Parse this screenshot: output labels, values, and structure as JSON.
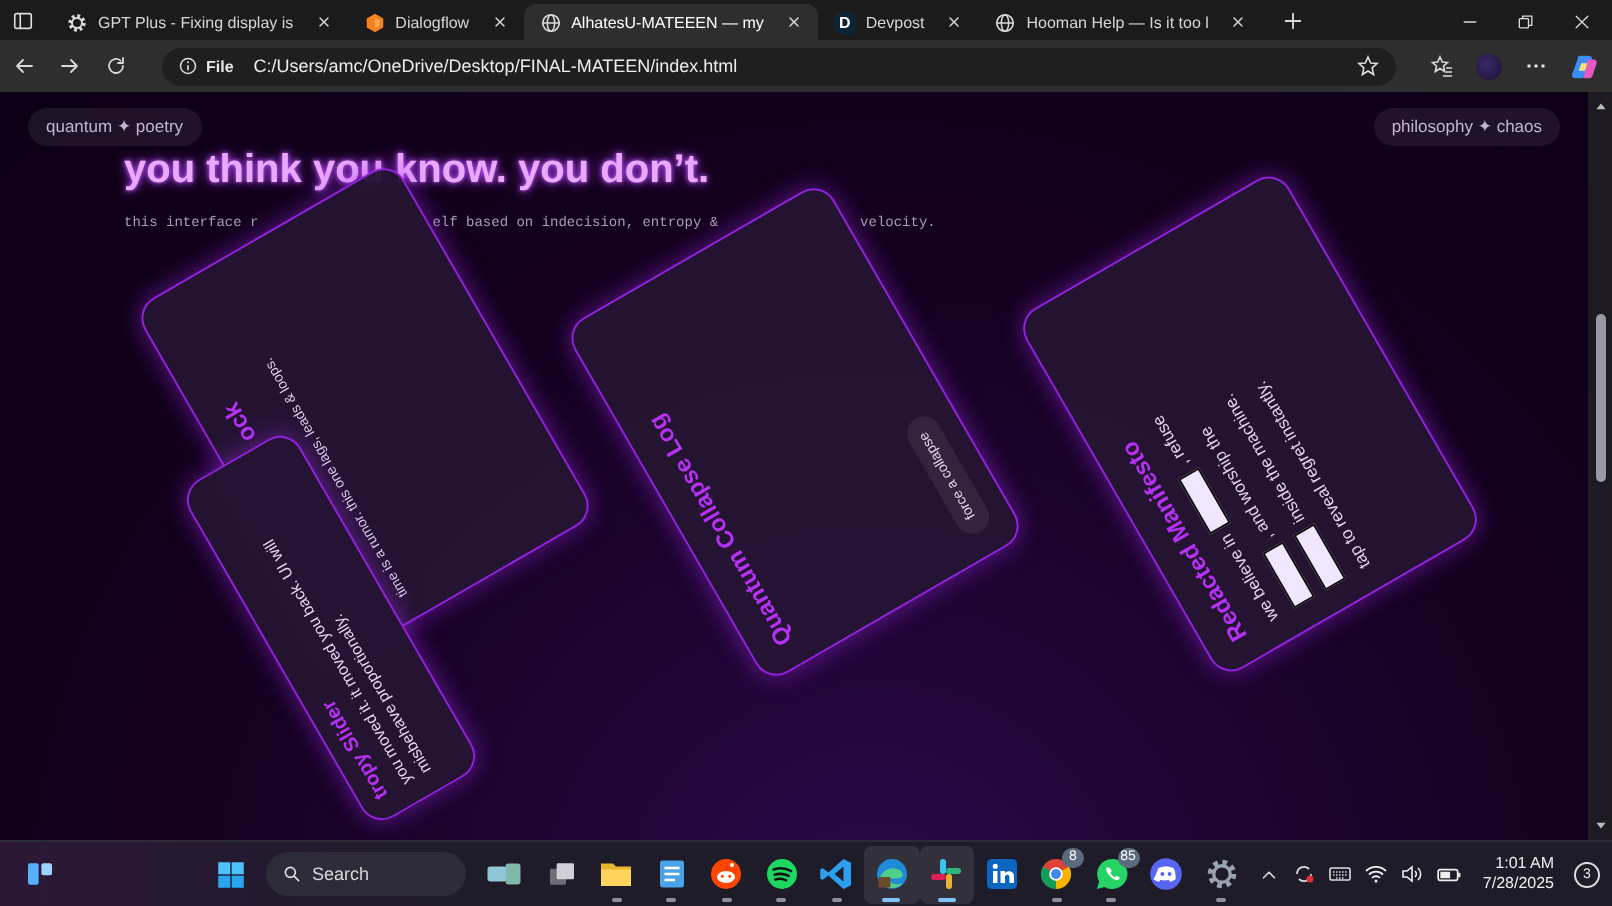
{
  "browser": {
    "tabs": [
      {
        "title": "GPT Plus - Fixing display is",
        "kind": "gear",
        "selected": false
      },
      {
        "title": "Dialogflow",
        "kind": "hexagon",
        "selected": false
      },
      {
        "title": "AlhatesU-MATEEEN — my",
        "kind": "globe",
        "selected": true
      },
      {
        "title": "Devpost",
        "kind": "letter",
        "favicon_text": "D",
        "selected": false
      },
      {
        "title": "Hooman Help — Is it too l",
        "kind": "globe",
        "selected": false
      }
    ],
    "address": {
      "scheme_label": "File",
      "url": "C:/Users/amc/OneDrive/Desktop/FINAL-MATEEN/index.html"
    }
  },
  "page": {
    "tags": [
      "quantum ✦ poetry",
      "philosophy ✦ chaos"
    ],
    "headline": "you think you know. you don’t.",
    "subtitle_fragments": [
      "this interface r",
      "elf based on indecision, entropy &",
      "velocity."
    ],
    "cards": [
      {
        "kind": "clock",
        "title": "ock",
        "body": "time is a rumor. this one lags, leads & loops."
      },
      {
        "kind": "collapse",
        "title": "Quantum Collapse Log",
        "button": "force a collapse"
      },
      {
        "kind": "manifesto",
        "title": "Redacted Manifesto",
        "lines": [
          [
            {
              "kind": "text",
              "text": "we believe in"
            },
            {
              "kind": "redacted"
            },
            {
              "kind": "text",
              "text": ", refuse"
            }
          ],
          [
            {
              "kind": "redacted"
            },
            {
              "kind": "text",
              "text": ", and worship the"
            }
          ],
          [
            {
              "kind": "redacted"
            },
            {
              "kind": "text",
              "text": "inside the machine."
            }
          ]
        ],
        "hint": "tap to reveal regret instantly."
      },
      {
        "kind": "slider",
        "title": "tropy Slider",
        "body": [
          "you moved it. it moved you back. UI will",
          "misbehave proportionally."
        ]
      }
    ]
  },
  "taskbar": {
    "search": {
      "placeholder": "Search"
    },
    "apps": [
      {
        "kind": "folder",
        "open": true,
        "selected": false
      },
      {
        "kind": "notepad",
        "open": true,
        "selected": false
      },
      {
        "kind": "reddit",
        "open": true,
        "selected": false
      },
      {
        "kind": "spotify",
        "open": true,
        "selected": false
      },
      {
        "kind": "vscode",
        "open": true,
        "selected": false
      },
      {
        "kind": "edge",
        "open": true,
        "selected": true
      },
      {
        "kind": "slack",
        "open": true,
        "selected": true
      },
      {
        "kind": "linkedin",
        "open": false,
        "selected": false
      },
      {
        "kind": "chrome",
        "open": true,
        "selected": false,
        "badge": "8"
      },
      {
        "kind": "whatsapp",
        "open": true,
        "selected": false,
        "badge": "85"
      },
      {
        "kind": "discord",
        "open": false,
        "selected": false
      },
      {
        "kind": "settings",
        "open": true,
        "selected": false
      }
    ],
    "tray": {
      "time": "1:01 AM",
      "date": "7/28/2025",
      "notification_count": "3"
    }
  }
}
